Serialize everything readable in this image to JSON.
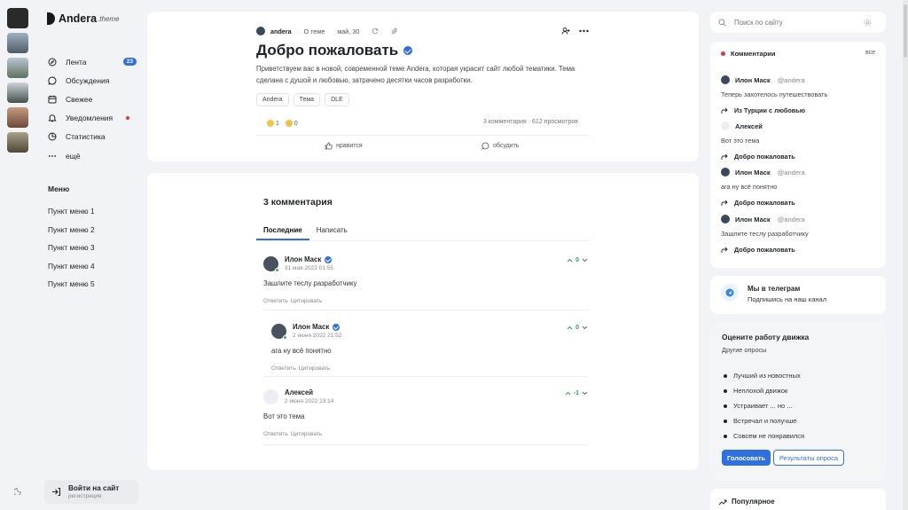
{
  "app": {
    "name": "Andera",
    "name_suffix": ".theme"
  },
  "rail": {
    "thumb_colors": [
      "#2a2a2a",
      "#6f7f8c",
      "#7d8e7a",
      "#5d6c64",
      "#8a6b5a",
      "#7a6f5e"
    ]
  },
  "nav": {
    "items": [
      {
        "label": "Лента",
        "icon": "compass-icon",
        "badge": "23"
      },
      {
        "label": "Обсуждения",
        "icon": "chat-bubble-icon"
      },
      {
        "label": "Свежее",
        "icon": "calendar-icon"
      },
      {
        "label": "Уведомления",
        "icon": "bell-icon",
        "has_dot": true
      },
      {
        "label": "Статистика",
        "icon": "pie-chart-icon"
      },
      {
        "label": "ещё",
        "icon": "more-icon"
      }
    ]
  },
  "menu": {
    "title": "Меню",
    "items": [
      "Пункт меню 1",
      "Пункт меню 2",
      "Пункт меню 3",
      "Пункт меню 4",
      "Пункт меню 5"
    ]
  },
  "login": {
    "title": "Войти на сайт",
    "subtitle": "регистрация"
  },
  "post": {
    "author": "andera",
    "section": "О теме",
    "date": "май, 30",
    "title": "Добро пожаловать",
    "description": "Приветствуем вас в новой, современной теме Andera, которая украсит сайт любой тематики. Тема сделана с душой и любовью, затрачено десятки часов разработки.",
    "tags": [
      "Andera",
      "Тема",
      "DLE"
    ],
    "reaction_1": "1",
    "reaction_2": "0",
    "stats": "3 комментария · 612 просмотров",
    "like_label": "нравится",
    "discuss_label": "обсудить"
  },
  "comments": {
    "title": "3 комментария",
    "tabs": [
      "Последние",
      "Написать"
    ],
    "reply_label": "Ответить",
    "quote_label": "Цитировать",
    "list": [
      {
        "name": "Илон Маск",
        "date": "31 мая 2022 01:55",
        "text": "Зашлите теслу разработчику",
        "votes": "0"
      },
      {
        "name": "Илон Маск",
        "date": "2 июня 2022 21:52",
        "text": "ага ну всё понятно",
        "votes": "0"
      },
      {
        "name": "Алексей",
        "date": "2 июня 2022 23:14",
        "text": "Вот это тема",
        "votes": "-1"
      }
    ]
  },
  "search": {
    "placeholder": "Поиск по сайту"
  },
  "recent": {
    "title": "Комментарии",
    "all_label": "все",
    "items": [
      {
        "name": "Илон Маск",
        "nick": "@andera",
        "text": "Теперь захотелось путешествовать",
        "link": "Из Турции с любовью"
      },
      {
        "name": "Алексей",
        "nick": "",
        "text": "Вот это тема",
        "link": "Добро пожаловать"
      },
      {
        "name": "Илон Маск",
        "nick": "@andera",
        "text": "ага ну всё понятно",
        "link": "Добро пожаловать"
      },
      {
        "name": "Илон Маск",
        "nick": "@andera",
        "text": "Зашлите теслу разработчику",
        "link": "Добро пожаловать"
      }
    ]
  },
  "telegram": {
    "title": "Мы в телеграм",
    "subtitle": "Подпишись на наш канал"
  },
  "poll": {
    "title": "Оцените работу движка",
    "subtitle": "Другие опросы",
    "options": [
      "Лучший из новостных",
      "Неплохой движок",
      "Устраивает ... но ...",
      "Встречал и получше",
      "Совсем не понравился"
    ],
    "vote_label": "Голосовать",
    "results_label": "Результаты опроса"
  },
  "popular": {
    "title": "Популярное"
  },
  "colors": {
    "accent": "#2f6fe0",
    "online": "#3db35a",
    "notify": "#e2343f",
    "vote": "#2e9d4c"
  }
}
